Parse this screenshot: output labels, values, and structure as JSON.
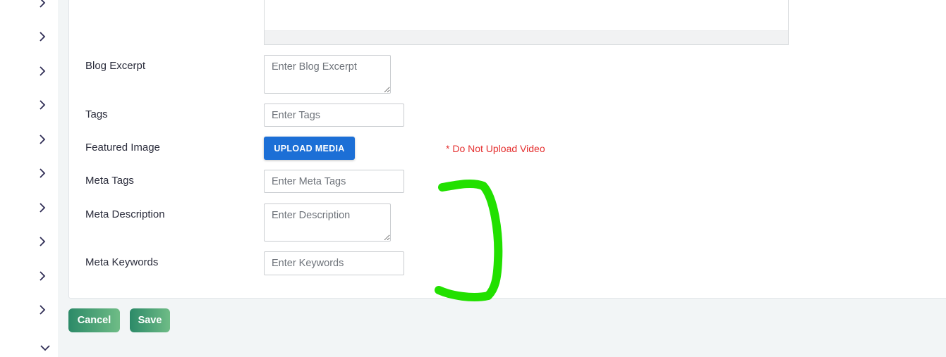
{
  "form": {
    "blog_excerpt": {
      "label": "Blog Excerpt",
      "placeholder": "Enter Blog Excerpt"
    },
    "tags": {
      "label": "Tags",
      "placeholder": "Enter Tags"
    },
    "featured_image": {
      "label": "Featured Image",
      "button_label": "UPLOAD MEDIA",
      "warning": "* Do Not Upload Video"
    },
    "meta_tags": {
      "label": "Meta Tags",
      "placeholder": "Enter Meta Tags"
    },
    "meta_description": {
      "label": "Meta Description",
      "placeholder": "Enter Description"
    },
    "meta_keywords": {
      "label": "Meta Keywords",
      "placeholder": "Enter Keywords"
    }
  },
  "actions": {
    "cancel_label": "Cancel",
    "save_label": "Save"
  },
  "sidebar": {
    "items": [
      {
        "icon": "chevron-right-icon"
      },
      {
        "icon": "chevron-right-icon"
      },
      {
        "icon": "chevron-right-icon"
      },
      {
        "icon": "chevron-right-icon"
      },
      {
        "icon": "chevron-right-icon"
      },
      {
        "icon": "chevron-right-icon"
      },
      {
        "icon": "chevron-right-icon"
      },
      {
        "icon": "chevron-right-icon"
      },
      {
        "icon": "chevron-right-icon"
      },
      {
        "icon": "chevron-right-icon"
      },
      {
        "icon": "chevron-down-icon"
      }
    ]
  },
  "colors": {
    "primary_button": "#1c6fd6",
    "warning_text": "#e53030",
    "action_gradient_start": "#2c8a68",
    "action_gradient_end": "#6fbc86",
    "annotation_stroke": "#22e000"
  }
}
